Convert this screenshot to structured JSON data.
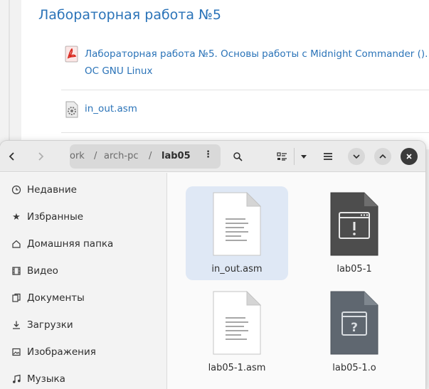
{
  "background_page": {
    "section_title": "Лабораторная работа №5",
    "items": [
      {
        "text_line1": "Лабораторная работа №5. Основы работы с Midnight Commander (). Стр",
        "text_line2": "ОС GNU Linux",
        "icon": "pdf-icon"
      },
      {
        "text_line1": "in_out.asm",
        "icon": "file-settings-icon"
      }
    ]
  },
  "file_manager": {
    "path_segments": [
      "ork",
      "arch-pc",
      "lab05"
    ],
    "path_separator": "/",
    "sidebar": [
      {
        "label": "Недавние",
        "icon": "clock-icon"
      },
      {
        "label": "Избранные",
        "icon": "star-icon"
      },
      {
        "label": "Домашняя папка",
        "icon": "home-icon"
      },
      {
        "label": "Видео",
        "icon": "video-icon"
      },
      {
        "label": "Документы",
        "icon": "documents-icon"
      },
      {
        "label": "Загрузки",
        "icon": "download-icon"
      },
      {
        "label": "Изображения",
        "icon": "image-icon"
      },
      {
        "label": "Музыка",
        "icon": "music-icon"
      }
    ],
    "files": [
      {
        "name": "in_out.asm",
        "type": "text",
        "selected": true
      },
      {
        "name": "lab05-1",
        "type": "executable",
        "selected": false
      },
      {
        "name": "lab05-1.asm",
        "type": "text",
        "selected": false
      },
      {
        "name": "lab05-1.o",
        "type": "unknown",
        "selected": false
      }
    ]
  },
  "colors": {
    "accent": "#2a73b8",
    "selection": "#dfe8f5",
    "header": "#ebebeb"
  }
}
